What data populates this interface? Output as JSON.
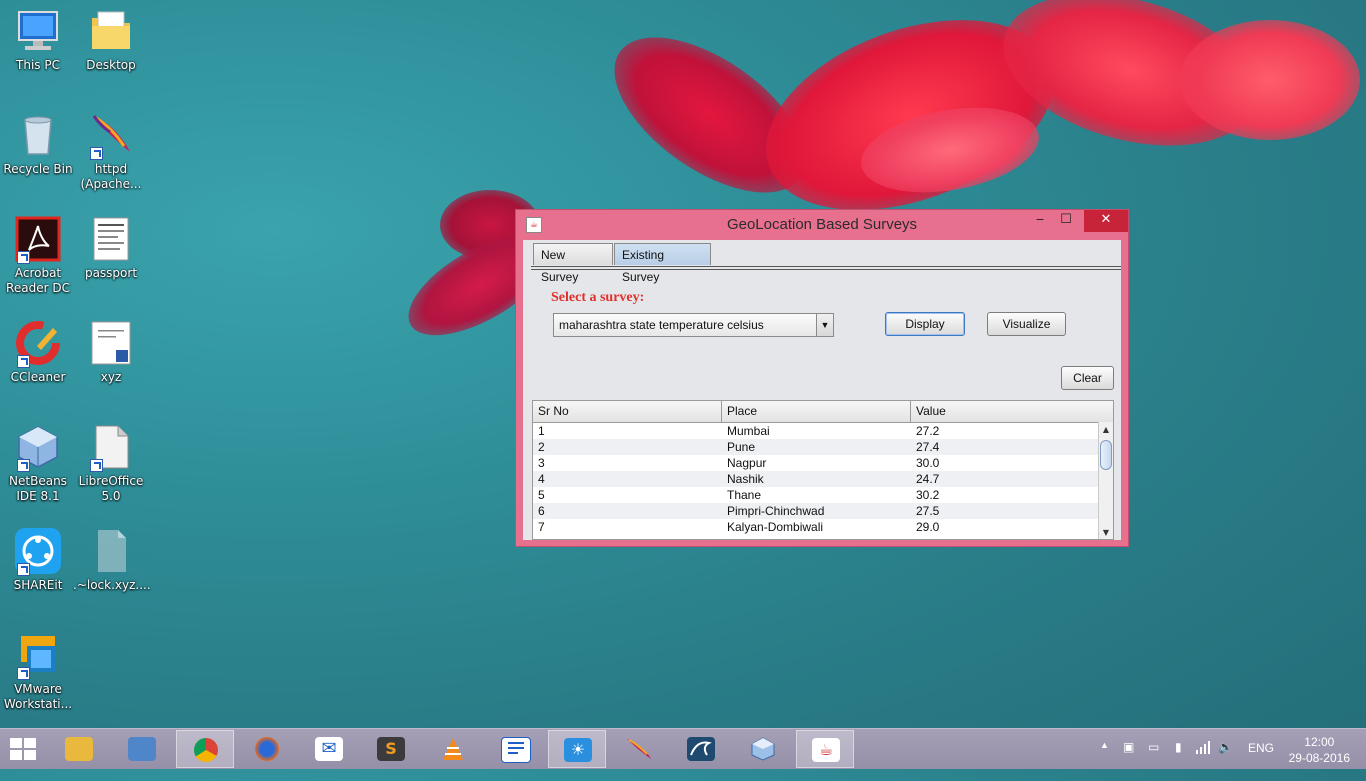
{
  "desktop": {
    "icons": [
      {
        "label": "This PC"
      },
      {
        "label": "Desktop"
      },
      {
        "label": "Recycle Bin"
      },
      {
        "label": "httpd (Apache..."
      },
      {
        "label": "Acrobat Reader DC"
      },
      {
        "label": "passport"
      },
      {
        "label": "CCleaner"
      },
      {
        "label": "xyz"
      },
      {
        "label": "NetBeans IDE 8.1"
      },
      {
        "label": "LibreOffice 5.0"
      },
      {
        "label": "SHAREit"
      },
      {
        "label": ".~lock.xyz...."
      },
      {
        "label": "VMware Workstati..."
      }
    ]
  },
  "window": {
    "title": "GeoLocation Based Surveys",
    "minimize": "‒",
    "maximize": "☐",
    "close": "✕",
    "tabs": [
      {
        "label": "New Survey"
      },
      {
        "label": "Existing Survey"
      }
    ],
    "select_label": "Select a survey:",
    "selected_survey": "maharashtra state temperature celsius",
    "buttons": {
      "display": "Display",
      "visualize": "Visualize",
      "clear": "Clear"
    },
    "table": {
      "columns": [
        "Sr No",
        "Place",
        "Value"
      ],
      "rows": [
        [
          "1",
          "Mumbai",
          "27.2"
        ],
        [
          "2",
          "Pune",
          "27.4"
        ],
        [
          "3",
          "Nagpur",
          "30.0"
        ],
        [
          "4",
          "Nashik",
          "24.7"
        ],
        [
          "5",
          "Thane",
          "30.2"
        ],
        [
          "6",
          "Pimpri-Chinchwad",
          "27.5"
        ],
        [
          "7",
          "Kalyan-Dombiwali",
          "29.0"
        ]
      ]
    }
  },
  "taskbar": {
    "apps": [
      {
        "icon": "file-explorer-icon"
      },
      {
        "icon": "control-panel-icon"
      },
      {
        "icon": "chrome-icon"
      },
      {
        "icon": "firefox-icon"
      },
      {
        "icon": "mail-icon"
      },
      {
        "icon": "sublime-text-icon",
        "glyph": "S"
      },
      {
        "icon": "vlc-icon"
      },
      {
        "icon": "writer-icon"
      },
      {
        "icon": "weather-icon"
      },
      {
        "icon": "apache-feather-icon"
      },
      {
        "icon": "mysql-icon"
      },
      {
        "icon": "netbeans-icon"
      },
      {
        "icon": "java-icon"
      }
    ],
    "language": "ENG",
    "time": "12:00",
    "date": "29-08-2016"
  },
  "colors": {
    "window_frame": "#e8708f",
    "close_button": "#c7243a",
    "select_label": "#e0302c"
  }
}
